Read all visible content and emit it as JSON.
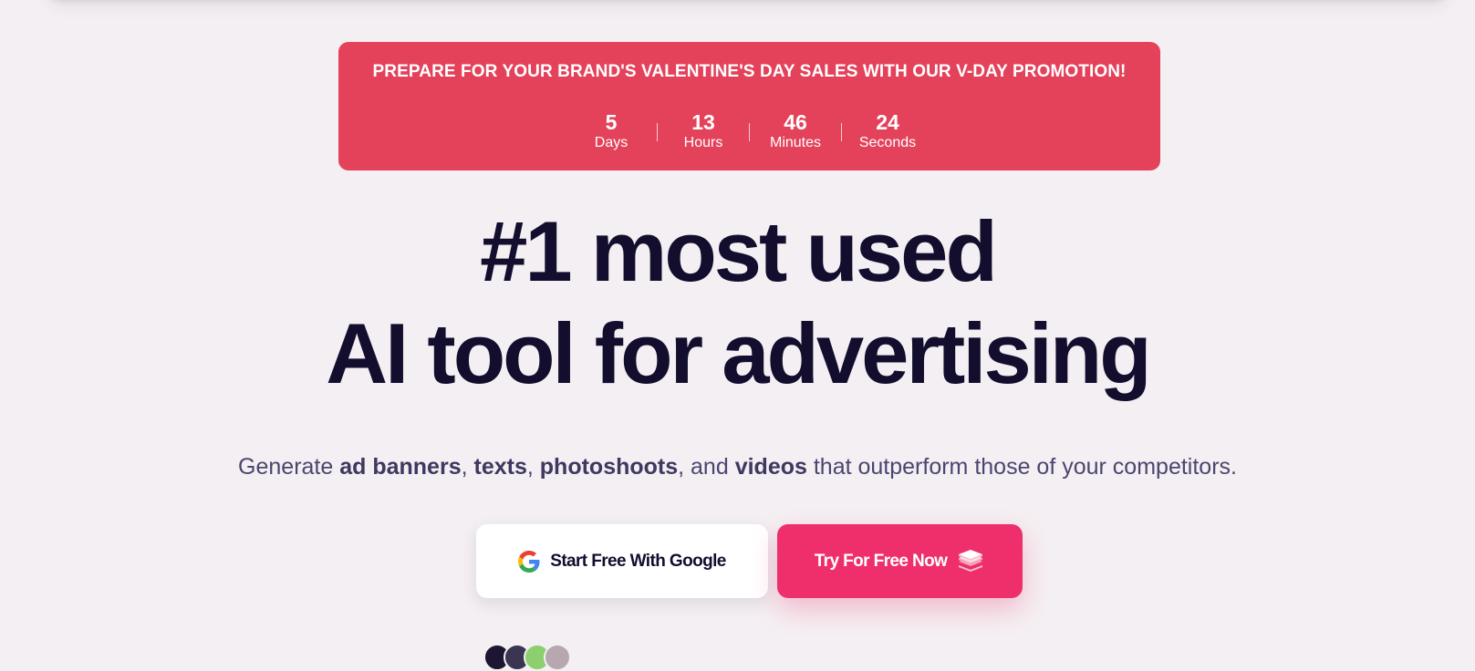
{
  "promo": {
    "title": "PREPARE FOR YOUR BRAND'S VALENTINE'S DAY SALES WITH OUR V-DAY PROMOTION!",
    "countdown": [
      {
        "value": "5",
        "label": "Days"
      },
      {
        "value": "13",
        "label": "Hours"
      },
      {
        "value": "46",
        "label": "Minutes"
      },
      {
        "value": "24",
        "label": "Seconds"
      }
    ],
    "background_color": "#e3425a"
  },
  "hero": {
    "headline_line1": "#1 most used",
    "headline_line2": "AI tool for advertising",
    "subheadline": {
      "prefix": "Generate ",
      "item1": "ad banners",
      "sep1": ", ",
      "item2": "texts",
      "sep2": ", ",
      "item3": "photoshoots",
      "sep3": ", and ",
      "item4": "videos",
      "suffix": " that outperform those of your competitors."
    }
  },
  "cta": {
    "google_button_label": "Start Free With Google",
    "try_button_label": "Try For Free Now",
    "google_icon": "google-g-icon",
    "try_icon": "layers-icon",
    "accent_color": "#ee2f6c"
  },
  "social_proof": {
    "avatar_colors": [
      "#1c1633",
      "#3a3550",
      "#8ccf6e",
      "#b7a7ae"
    ]
  }
}
